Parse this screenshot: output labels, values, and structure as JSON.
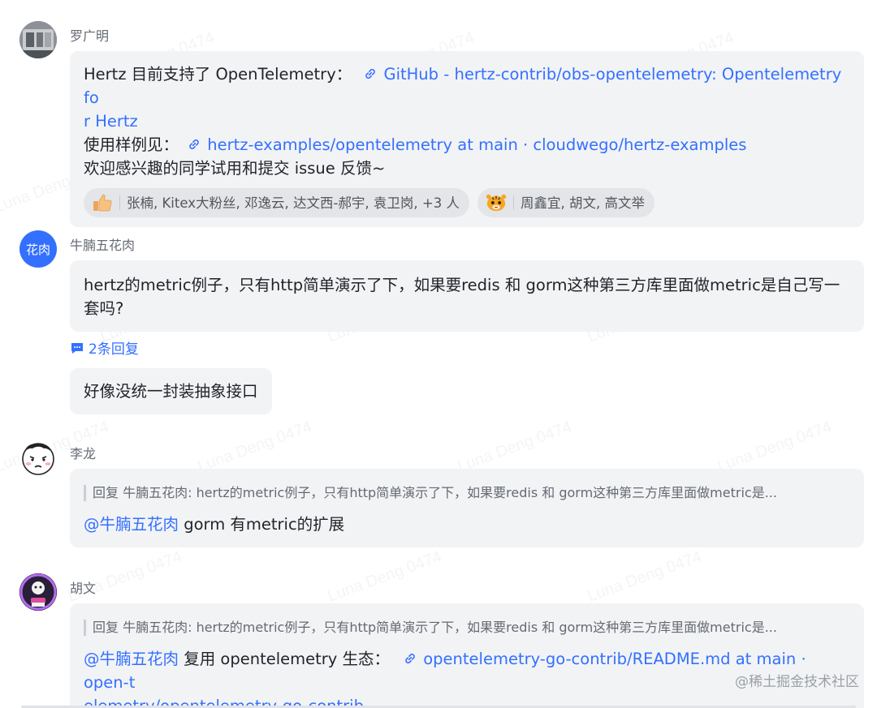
{
  "watermark": "Luna Deng 0474",
  "messages": [
    {
      "author": "罗广明",
      "line1_text": "Hertz 目前支持了 OpenTelemetry：",
      "line1_link": "GitHub - hertz-contrib/obs-opentelemetry: Opentelemetry fo",
      "line1_link_cont": "r Hertz",
      "line2_text": "使用样例见：",
      "line2_link": "hertz-examples/opentelemetry at main · cloudwego/hertz-examples",
      "line3_text": "欢迎感兴趣的同学试用和提交 issue 反馈~",
      "reactions": [
        {
          "emoji": "thumbs-up-icon",
          "users": "张楠, Kitex大粉丝, 邓逸云, 达文西-郝宇, 袁卫岗,  +3 人"
        },
        {
          "emoji": "tiger-icon",
          "users": "周鑫宜, 胡文, 高文举"
        }
      ]
    },
    {
      "author": "牛腩五花肉",
      "avatar_text": "花肉",
      "text": "hertz的metric例子，只有http简单演示了下，如果要redis 和 gorm这种第三方库里面做metric是自己写一套吗?",
      "replies": "2条回复",
      "followup": "好像没统一封装抽象接口"
    },
    {
      "author": "李龙",
      "quote": "回复 牛腩五花肉: hertz的metric例子，只有http简单演示了下，如果要redis 和 gorm这种第三方库里面做metric是...",
      "mention": "@牛腩五花肉",
      "text": " gorm 有metric的扩展"
    },
    {
      "author": "胡文",
      "quote": "回复 牛腩五花肉: hertz的metric例子，只有http简单演示了下，如果要redis 和 gorm这种第三方库里面做metric是...",
      "mention": "@牛腩五花肉",
      "text": " 复用 opentelemetry 生态：",
      "link": "opentelemetry-go-contrib/README.md at main · open-t",
      "link_cont": "elemetry/opentelemetry-go-contrib"
    }
  ],
  "footer": "@稀土掘金技术社区",
  "colors": {
    "link": "#3370ff",
    "bubble": "#f2f3f5",
    "avatar_blue": "#3370ff"
  }
}
